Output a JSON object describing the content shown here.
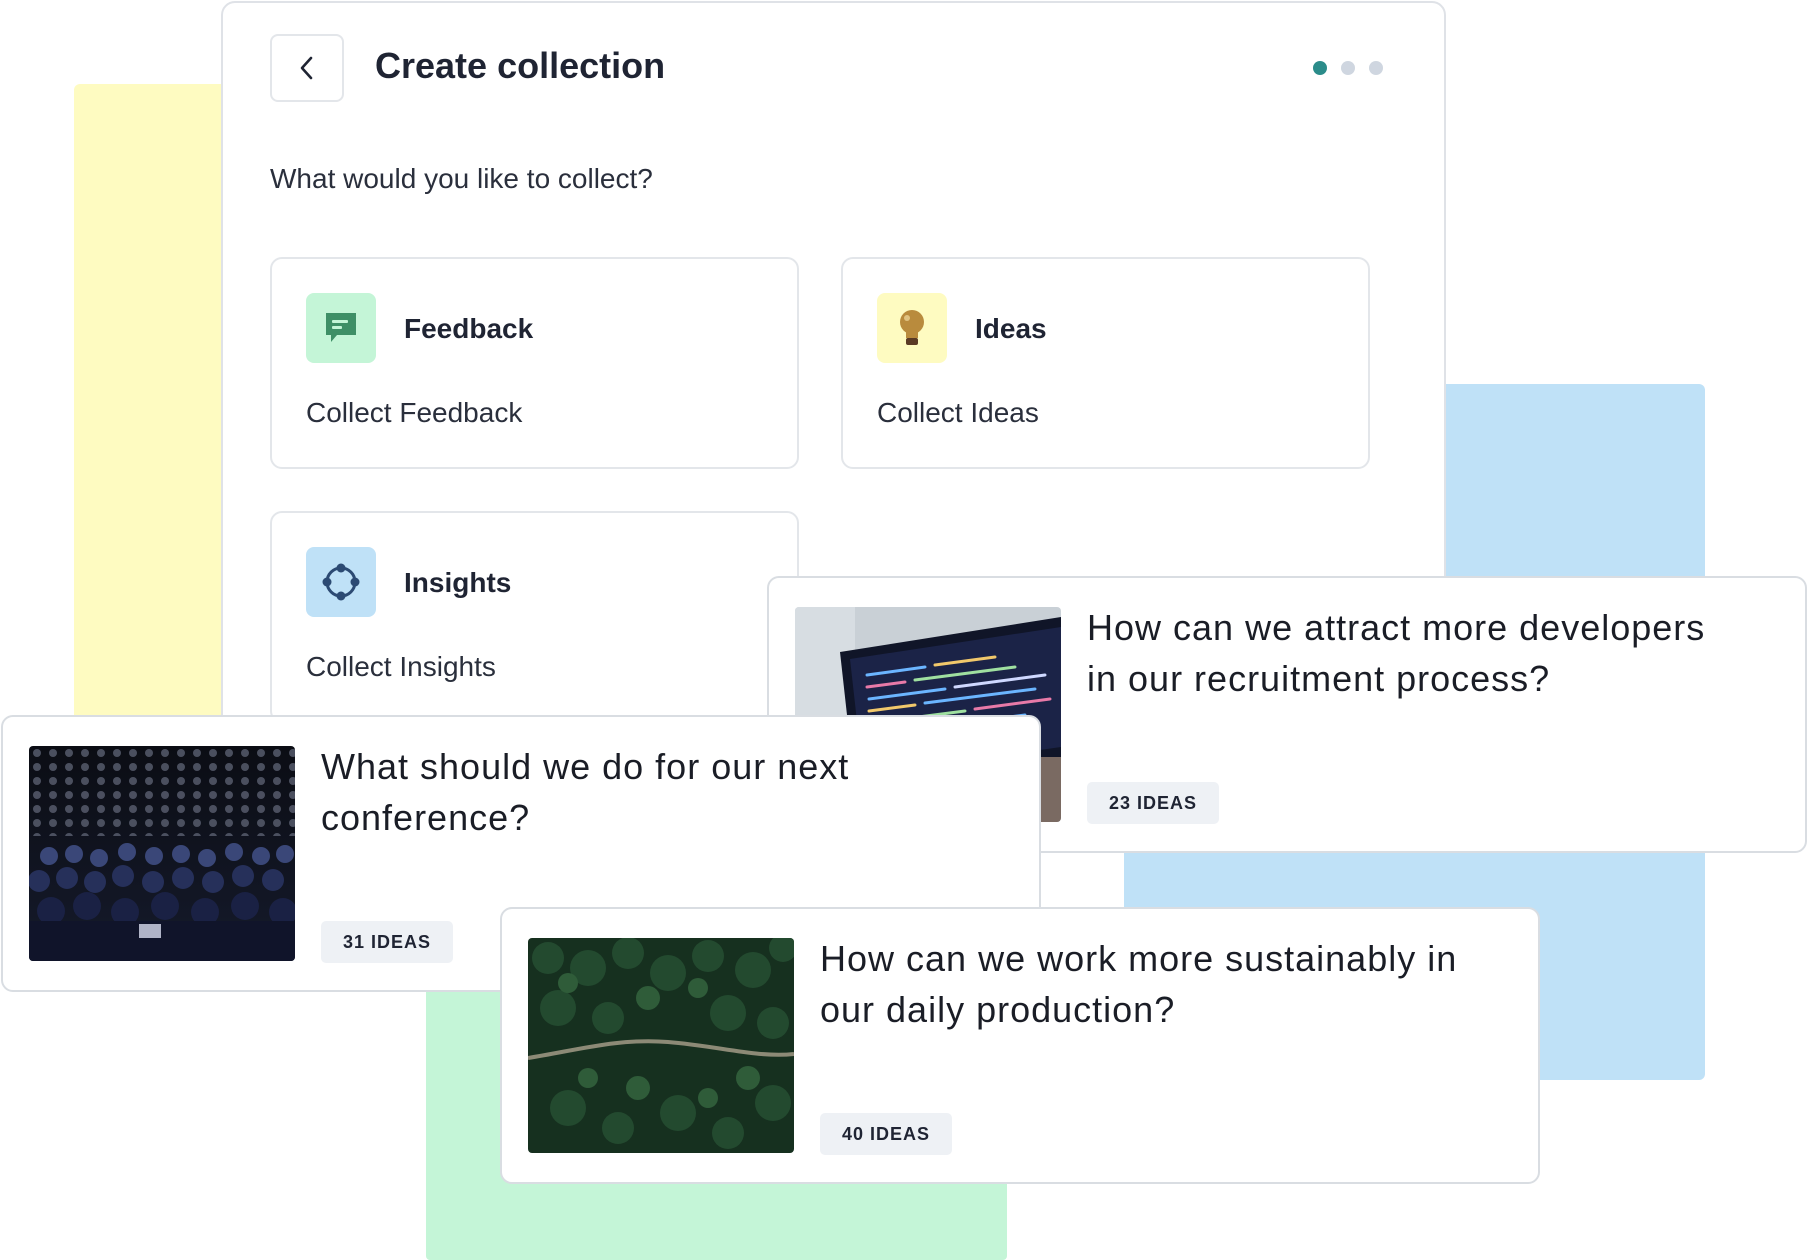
{
  "panel": {
    "title": "Create collection",
    "question": "What would you like to collect?",
    "steps": {
      "total": 3,
      "current": 1
    }
  },
  "options": [
    {
      "title": "Feedback",
      "description": "Collect Feedback",
      "icon": "chat-icon",
      "icon_bg": "#c4f5d7"
    },
    {
      "title": "Ideas",
      "description": "Collect Ideas",
      "icon": "lightbulb-icon",
      "icon_bg": "#fefbc1"
    },
    {
      "title": "Insights",
      "description": "Collect Insights",
      "icon": "insights-icon",
      "icon_bg": "#bfe1f7"
    }
  ],
  "cards": [
    {
      "question": "How can we attract more developers in our recruitment process?",
      "badge": "23 IDEAS",
      "image": "code-monitor"
    },
    {
      "question": "What should we do for our next conference?",
      "badge": "31 IDEAS",
      "image": "conference-audience"
    },
    {
      "question": "How can we work more sustainably in our daily production?",
      "badge": "40 IDEAS",
      "image": "forest-road"
    }
  ],
  "colors": {
    "accent": "#2b8c8a",
    "yellow": "#fefbc1",
    "blue": "#bfe1f7",
    "green": "#c4f5d7"
  }
}
